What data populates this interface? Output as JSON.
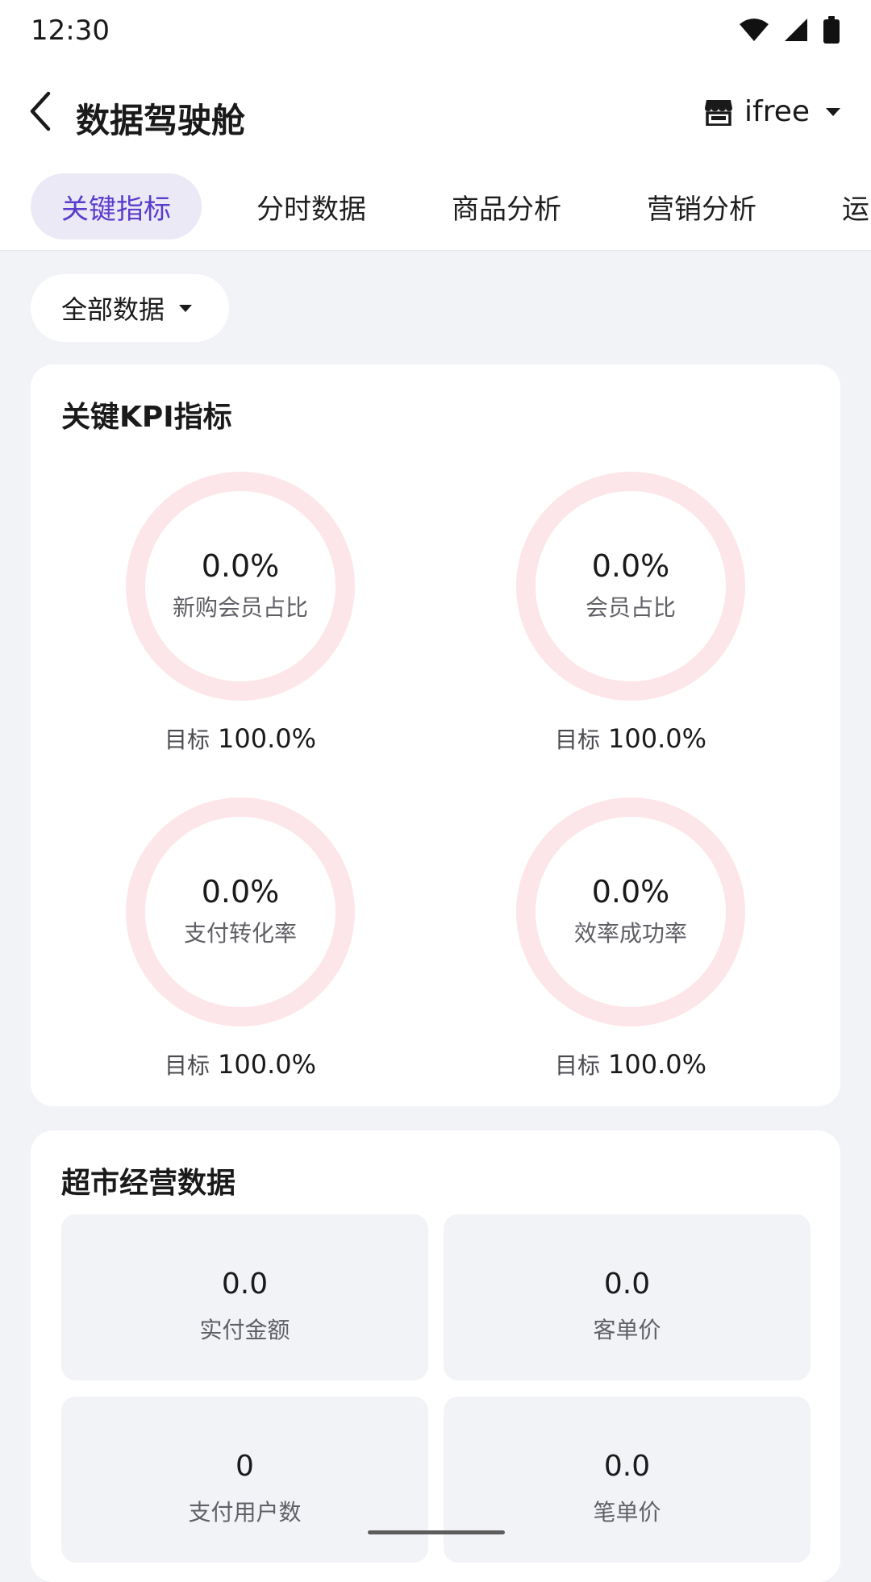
{
  "status_bar": {
    "time": "12:30",
    "icons": [
      "wifi-icon",
      "signal-icon",
      "battery-icon"
    ]
  },
  "app_bar": {
    "title": "数据驾驶舱",
    "store_name": "ifree",
    "back_icon": "chevron-left-icon",
    "store_icon": "store-icon"
  },
  "tabs": [
    {
      "label": "关键指标",
      "active": true
    },
    {
      "label": "分时数据",
      "active": false
    },
    {
      "label": "商品分析",
      "active": false
    },
    {
      "label": "营销分析",
      "active": false
    },
    {
      "label": "运营分析",
      "active": false
    }
  ],
  "filter": {
    "label": "全部数据"
  },
  "kpi_card": {
    "title": "关键KPI指标",
    "target_label": "目标",
    "items": [
      {
        "value": "0.0%",
        "label": "新购会员占比",
        "target": "100.0%",
        "progress": 0
      },
      {
        "value": "0.0%",
        "label": "会员占比",
        "target": "100.0%",
        "progress": 0
      },
      {
        "value": "0.0%",
        "label": "支付转化率",
        "target": "100.0%",
        "progress": 0
      },
      {
        "value": "0.0%",
        "label": "效率成功率",
        "target": "100.0%",
        "progress": 0
      }
    ]
  },
  "ops_card": {
    "title": "超市经营数据",
    "items": [
      {
        "value": "0.0",
        "label": "实付金额"
      },
      {
        "value": "0.0",
        "label": "客单价"
      },
      {
        "value": "0",
        "label": "支付用户数"
      },
      {
        "value": "0.0",
        "label": "笔单价"
      }
    ]
  },
  "colors": {
    "accent": "#5a3dcb",
    "tab_active_bg": "#ece9f7",
    "ring_track": "#fde6e9",
    "background": "#f2f3f6"
  }
}
